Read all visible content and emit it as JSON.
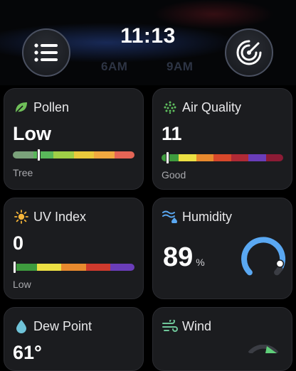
{
  "background": {
    "hours": [
      "6AM",
      "9AM"
    ]
  },
  "header": {
    "time": "11:13",
    "menu_icon": "list-icon",
    "radar_icon": "radar-icon"
  },
  "colors": {
    "card_bg": "#1b1c1f",
    "humidity_ring": "#5aa8f2",
    "pollen_scale": [
      "#7aa17a",
      "#59b85a",
      "#9fcf47",
      "#e9c93c",
      "#f0a840",
      "#e46556"
    ],
    "aqi_scale": [
      "#3e9b3e",
      "#ece043",
      "#e88a2e",
      "#d8482b",
      "#b02a35",
      "#6a3db9",
      "#8c1b35"
    ],
    "uv_scale": [
      "#3e9b3e",
      "#ece043",
      "#e88a2e",
      "#cf3a2d",
      "#6a3db9"
    ]
  },
  "cards": {
    "pollen": {
      "title": "Pollen",
      "value": "Low",
      "sub": "Tree",
      "icon": "leaf-icon",
      "marker_level": 0.2
    },
    "air_quality": {
      "title": "Air Quality",
      "value": "11",
      "sub": "Good",
      "icon": "air-quality-icon",
      "marker_level": 0.03
    },
    "uv_index": {
      "title": "UV Index",
      "value": "0",
      "sub": "Low",
      "icon": "sun-icon",
      "marker_level": 0.0
    },
    "humidity": {
      "title": "Humidity",
      "value": "89",
      "unit": "%",
      "icon": "humidity-icon",
      "level": 0.89
    },
    "dew_point": {
      "title": "Dew Point",
      "value": "61°",
      "icon": "droplet-icon"
    },
    "wind": {
      "title": "Wind",
      "icon": "wind-icon"
    }
  }
}
